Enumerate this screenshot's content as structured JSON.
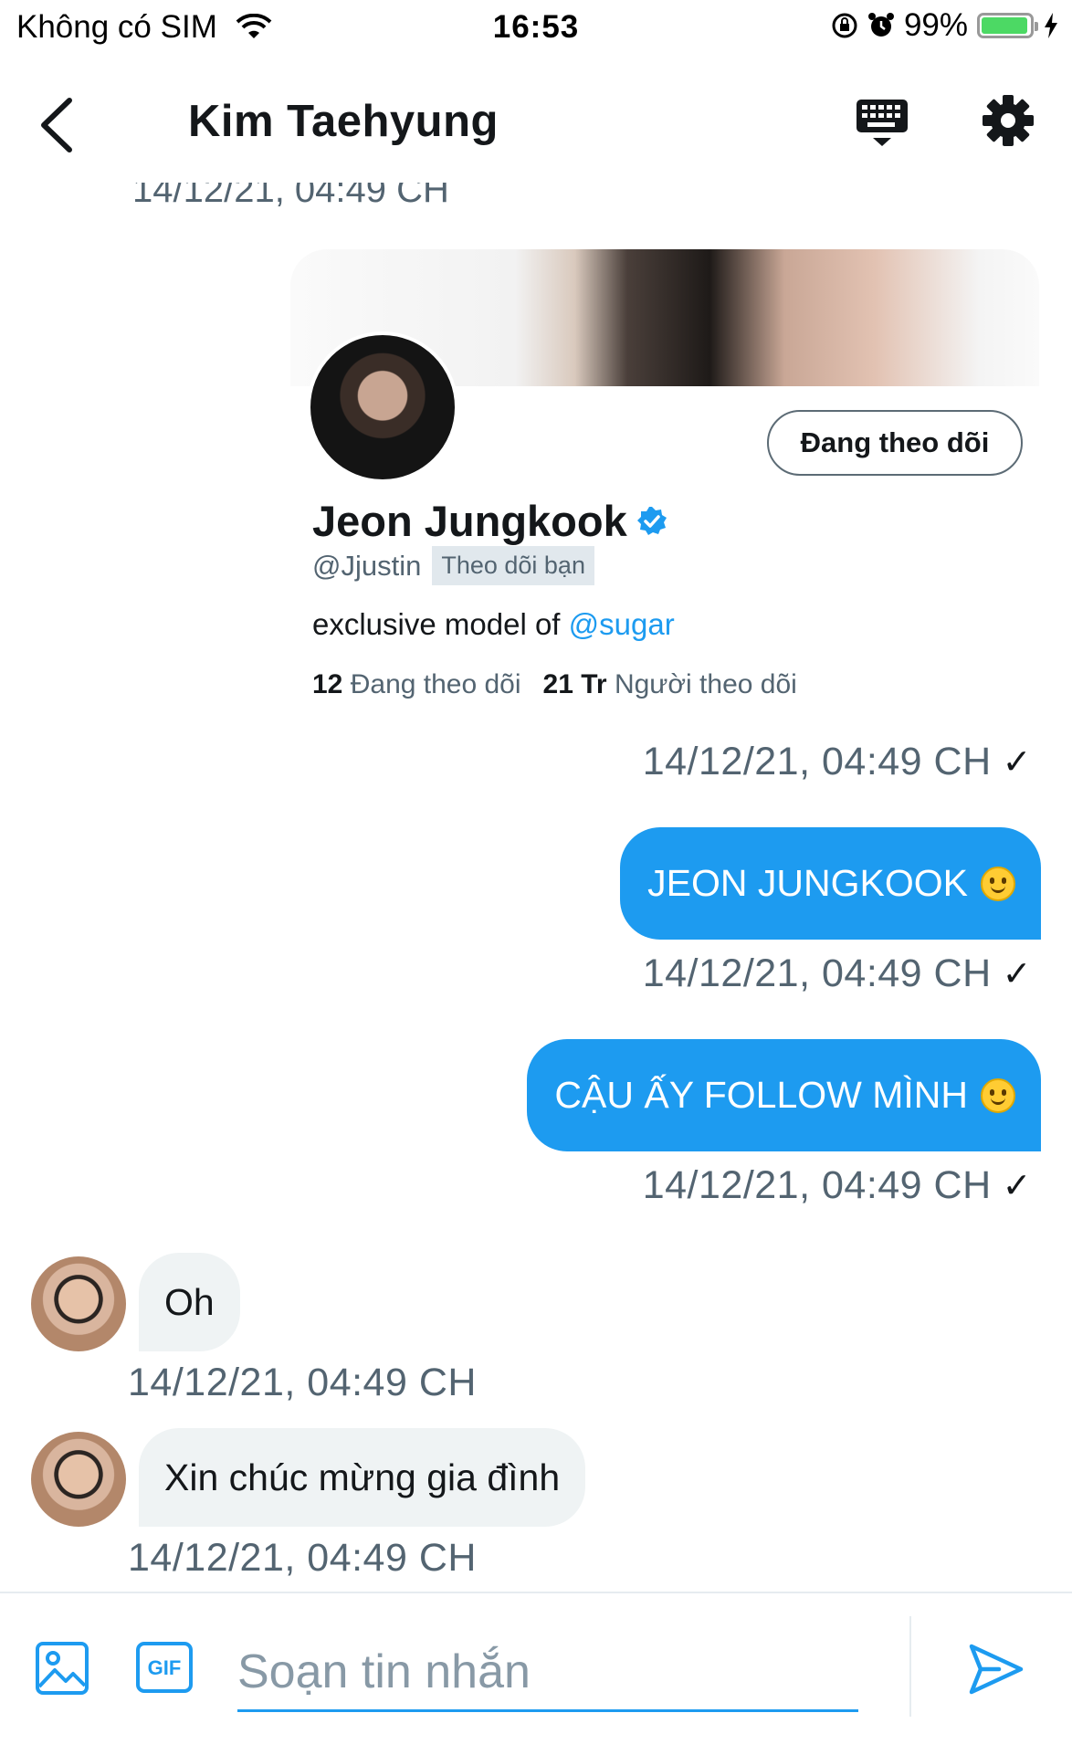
{
  "status": {
    "carrier": "Không có SIM",
    "time": "16:53",
    "battery": "99%",
    "battery_level": 0.99
  },
  "header": {
    "title": "Kim Taehyung"
  },
  "partial_timestamp": "14/12/21, 04:49 CH",
  "profile_card": {
    "name": "Jeon Jungkook",
    "handle": "@Jjustin",
    "follows_you": "Theo dõi bạn",
    "follow_button": "Đang theo dõi",
    "bio_prefix": "exclusive model of",
    "bio_mention": "@sugar",
    "following_count": "12",
    "following_label": "Đang theo dõi",
    "followers_count": "21 Tr",
    "followers_label": "Người theo dõi"
  },
  "messages": [
    {
      "direction": "out",
      "text": "JEON JUNGKOOK",
      "timestamp": "14/12/21, 04:49 CH"
    },
    {
      "direction": "out",
      "text": "CẬU ẤY FOLLOW MÌNH",
      "timestamp": "14/12/21, 04:49 CH"
    },
    {
      "direction": "in",
      "text": "Oh",
      "timestamp": "14/12/21, 04:49 CH"
    },
    {
      "direction": "in",
      "text": "Xin chúc mừng gia đình",
      "timestamp": "14/12/21, 04:49 CH"
    }
  ],
  "card_timestamp": "14/12/21, 04:49 CH",
  "composer": {
    "placeholder": "Soạn tin nhắn"
  },
  "icons": {
    "back": "chevron-left-icon",
    "keyboard": "keyboard-icon",
    "settings": "gear-icon",
    "image": "image-icon",
    "gif": "gif-icon",
    "send": "send-icon"
  },
  "colors": {
    "accent": "#1d9bf0",
    "incoming_bubble": "#eff3f4",
    "secondary_text": "#536471"
  }
}
